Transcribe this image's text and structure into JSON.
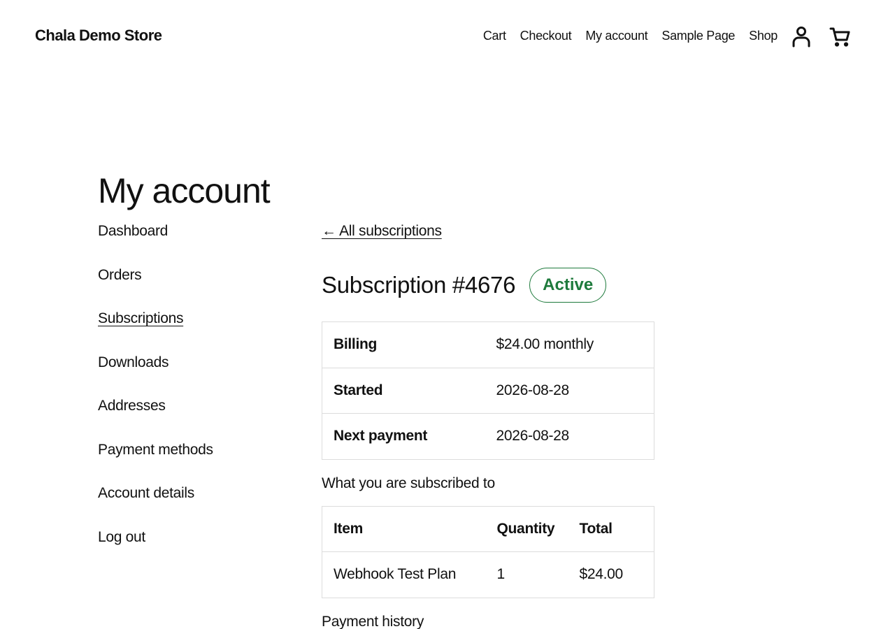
{
  "header": {
    "site_title": "Chala Demo Store",
    "nav": [
      {
        "label": "Cart"
      },
      {
        "label": "Checkout"
      },
      {
        "label": "My account"
      },
      {
        "label": "Sample Page"
      },
      {
        "label": "Shop"
      }
    ],
    "icons": [
      "account-icon",
      "cart-icon"
    ]
  },
  "page": {
    "title": "My account"
  },
  "account_nav": [
    {
      "label": "Dashboard"
    },
    {
      "label": "Orders"
    },
    {
      "label": "Subscriptions",
      "current": true
    },
    {
      "label": "Downloads"
    },
    {
      "label": "Addresses"
    },
    {
      "label": "Payment methods"
    },
    {
      "label": "Account details"
    },
    {
      "label": "Log out"
    }
  ],
  "subscription": {
    "back_link": "← All subscriptions",
    "title": "Subscription #4676",
    "status": "Active",
    "status_color": "#1e7a3c",
    "details": [
      {
        "label": "Billing",
        "value": "$24.00 monthly"
      },
      {
        "label": "Started",
        "value": "2026-08-28"
      },
      {
        "label": "Next payment",
        "value": "2026-08-28"
      }
    ],
    "items_heading": "What you are subscribed to",
    "items_columns": [
      "Item",
      "Quantity",
      "Total"
    ],
    "items": [
      {
        "item": "Webhook Test Plan",
        "quantity": "1",
        "total": "$24.00"
      }
    ],
    "payment_history_heading": "Payment history"
  }
}
